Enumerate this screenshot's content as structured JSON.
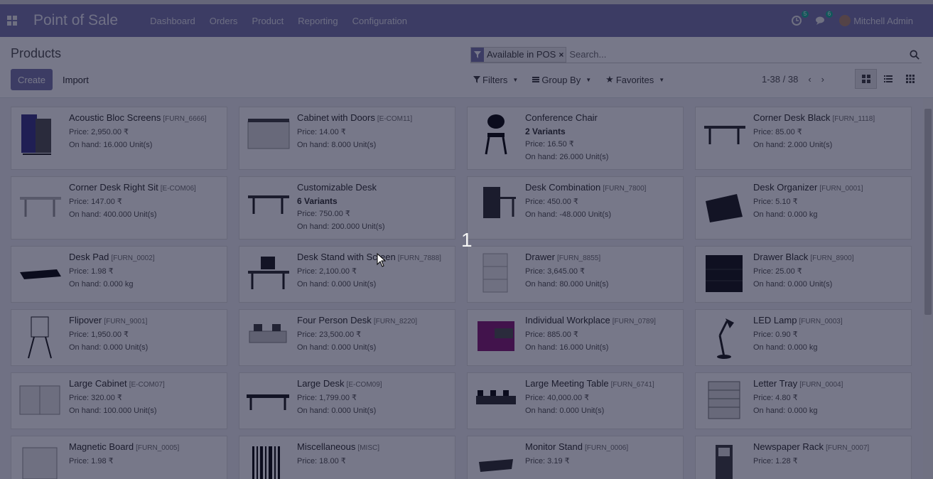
{
  "navbar": {
    "app_name": "Point of Sale",
    "menu": [
      "Dashboard",
      "Orders",
      "Product",
      "Reporting",
      "Configuration"
    ],
    "activity_badge": "5",
    "messages_badge": "6",
    "user": "Mitchell Admin"
  },
  "control": {
    "breadcrumb": "Products",
    "create_label": "Create",
    "import_label": "Import",
    "facet_label": "Available in POS",
    "search_placeholder": "Search...",
    "filters_label": "Filters",
    "group_by_label": "Group By",
    "favorites_label": "Favorites",
    "pager": "1-38 / 38"
  },
  "products": [
    {
      "name": "Acoustic Bloc Screens",
      "code": "[FURN_6666]",
      "price": "Price: 2,950.00 ₹",
      "onhand": "On hand: 16.000 Unit(s)",
      "variants": "",
      "icon": "screens"
    },
    {
      "name": "Cabinet with Doors",
      "code": "[E-COM11]",
      "price": "Price: 14.00 ₹",
      "onhand": "On hand: 8.000 Unit(s)",
      "variants": "",
      "icon": "cabinet"
    },
    {
      "name": "Conference Chair",
      "code": "",
      "price": "Price: 16.50 ₹",
      "onhand": "On hand: 26.000 Unit(s)",
      "variants": "2 Variants",
      "icon": "chair"
    },
    {
      "name": "Corner Desk Black",
      "code": "[FURN_1118]",
      "price": "Price: 85.00 ₹",
      "onhand": "On hand: 2.000 Unit(s)",
      "variants": "",
      "icon": "desk"
    },
    {
      "name": "Corner Desk Right Sit",
      "code": "[E-COM06]",
      "price": "Price: 147.00 ₹",
      "onhand": "On hand: 400.000 Unit(s)",
      "variants": "",
      "icon": "desk-light"
    },
    {
      "name": "Customizable Desk",
      "code": "",
      "price": "Price: 750.00 ₹",
      "onhand": "On hand: 200.000 Unit(s)",
      "variants": "6 Variants",
      "icon": "desk"
    },
    {
      "name": "Desk Combination",
      "code": "[FURN_7800]",
      "price": "Price: 450.00 ₹",
      "onhand": "On hand: -48.000 Unit(s)",
      "variants": "",
      "icon": "combination"
    },
    {
      "name": "Desk Organizer",
      "code": "[FURN_0001]",
      "price": "Price: 5.10 ₹",
      "onhand": "On hand: 0.000 kg",
      "variants": "",
      "icon": "organizer"
    },
    {
      "name": "Desk Pad",
      "code": "[FURN_0002]",
      "price": "Price: 1.98 ₹",
      "onhand": "On hand: 0.000 kg",
      "variants": "",
      "icon": "pad"
    },
    {
      "name": "Desk Stand with Screen",
      "code": "[FURN_7888]",
      "price": "Price: 2,100.00 ₹",
      "onhand": "On hand: 0.000 Unit(s)",
      "variants": "",
      "icon": "stand"
    },
    {
      "name": "Drawer",
      "code": "[FURN_8855]",
      "price": "Price: 3,645.00 ₹",
      "onhand": "On hand: 80.000 Unit(s)",
      "variants": "",
      "icon": "drawer"
    },
    {
      "name": "Drawer Black",
      "code": "[FURN_8900]",
      "price": "Price: 25.00 ₹",
      "onhand": "On hand: 0.000 Unit(s)",
      "variants": "",
      "icon": "drawer-black"
    },
    {
      "name": "Flipover",
      "code": "[FURN_9001]",
      "price": "Price: 1,950.00 ₹",
      "onhand": "On hand: 0.000 Unit(s)",
      "variants": "",
      "icon": "flipover"
    },
    {
      "name": "Four Person Desk",
      "code": "[FURN_8220]",
      "price": "Price: 23,500.00 ₹",
      "onhand": "On hand: 0.000 Unit(s)",
      "variants": "",
      "icon": "group-desk"
    },
    {
      "name": "Individual Workplace",
      "code": "[FURN_0789]",
      "price": "Price: 885.00 ₹",
      "onhand": "On hand: 16.000 Unit(s)",
      "variants": "",
      "icon": "workplace"
    },
    {
      "name": "LED Lamp",
      "code": "[FURN_0003]",
      "price": "Price: 0.90 ₹",
      "onhand": "On hand: 0.000 kg",
      "variants": "",
      "icon": "lamp"
    },
    {
      "name": "Large Cabinet",
      "code": "[E-COM07]",
      "price": "Price: 320.00 ₹",
      "onhand": "On hand: 100.000 Unit(s)",
      "variants": "",
      "icon": "large-cabinet"
    },
    {
      "name": "Large Desk",
      "code": "[E-COM09]",
      "price": "Price: 1,799.00 ₹",
      "onhand": "On hand: 0.000 Unit(s)",
      "variants": "",
      "icon": "large-desk"
    },
    {
      "name": "Large Meeting Table",
      "code": "[FURN_6741]",
      "price": "Price: 40,000.00 ₹",
      "onhand": "On hand: 0.000 Unit(s)",
      "variants": "",
      "icon": "meeting"
    },
    {
      "name": "Letter Tray",
      "code": "[FURN_0004]",
      "price": "Price: 4.80 ₹",
      "onhand": "On hand: 0.000 kg",
      "variants": "",
      "icon": "tray"
    },
    {
      "name": "Magnetic Board",
      "code": "[FURN_0005]",
      "price": "Price: 1.98 ₹",
      "onhand": "",
      "variants": "",
      "icon": "board"
    },
    {
      "name": "Miscellaneous",
      "code": "[MISC]",
      "price": "Price: 18.00 ₹",
      "onhand": "",
      "variants": "",
      "icon": "barcode"
    },
    {
      "name": "Monitor Stand",
      "code": "[FURN_0006]",
      "price": "Price: 3.19 ₹",
      "onhand": "",
      "variants": "",
      "icon": "monitor-stand"
    },
    {
      "name": "Newspaper Rack",
      "code": "[FURN_0007]",
      "price": "Price: 1.28 ₹",
      "onhand": "",
      "variants": "",
      "icon": "rack"
    }
  ],
  "overlay": {
    "step_number": "1"
  }
}
